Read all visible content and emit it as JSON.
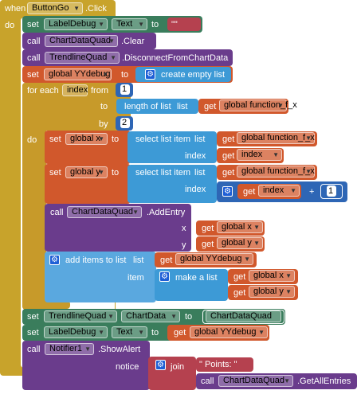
{
  "event": {
    "when": "when",
    "component": "ButtonGo",
    "event": ".Click",
    "do": "do"
  },
  "rows": {
    "set1": {
      "kw": "set",
      "comp": "LabelDebug",
      "prop": "Text",
      "to": "to",
      "value": "\"\""
    },
    "clear": {
      "kw": "call",
      "comp": "ChartDataQuad",
      "method": ".Clear"
    },
    "disconnect": {
      "kw": "call",
      "comp": "TrendlineQuad",
      "method": ".DisconnectFromChartData"
    },
    "yydebug": {
      "kw": "set",
      "var": "global YYdebug",
      "to": "to",
      "value": "create empty list"
    },
    "foreach": {
      "kw": "for each",
      "var": "index",
      "from": "from",
      "from_val": "1",
      "to": "to",
      "len": "length of list",
      "list": "list",
      "get": "get",
      "fx": "global function_f_x",
      "by": "by",
      "by_val": "2",
      "do": "do"
    },
    "setx": {
      "kw": "set",
      "var": "global x",
      "to": "to",
      "select": "select list item",
      "list": "list",
      "get": "get",
      "fx": "global function_f_x",
      "index": "index",
      "idx": "index"
    },
    "sety": {
      "kw": "set",
      "var": "global y",
      "to": "to",
      "select": "select list item",
      "list": "list",
      "get": "get",
      "fx": "global function_f_x",
      "index": "index",
      "idx": "index",
      "plus": "+",
      "one": "1"
    },
    "addentry": {
      "kw": "call",
      "comp": "ChartDataQuad",
      "method": ".AddEntry",
      "x": "x",
      "y": "y",
      "get": "get",
      "gx": "global x",
      "gy": "global y"
    },
    "additems": {
      "kw": "add items to list",
      "list": "list",
      "get": "get",
      "yy": "global YYdebug",
      "item": "item",
      "make": "make a list",
      "gx": "global x",
      "gy": "global y"
    },
    "setchart": {
      "kw": "set",
      "comp": "TrendlineQuad",
      "prop": "ChartData",
      "to": "to",
      "value": "ChartDataQuad"
    },
    "setlabel": {
      "kw": "set",
      "comp": "LabelDebug",
      "prop": "Text",
      "to": "to",
      "get": "get",
      "yy": "global YYdebug"
    },
    "alert": {
      "kw": "call",
      "comp": "Notifier1",
      "method": ".ShowAlert",
      "notice": "notice",
      "join": "join",
      "points": "\" Points: \"",
      "call": "call",
      "comp2": "ChartDataQuad",
      "method2": ".GetAllEntries"
    }
  },
  "colors": {
    "event": "#c8a32b",
    "component": "#3a7d5c",
    "call": "#6a3c8c",
    "variable": "#d1582c",
    "list": "#3d9ad6",
    "math": "#2e66b5",
    "text": "#b5414f"
  }
}
